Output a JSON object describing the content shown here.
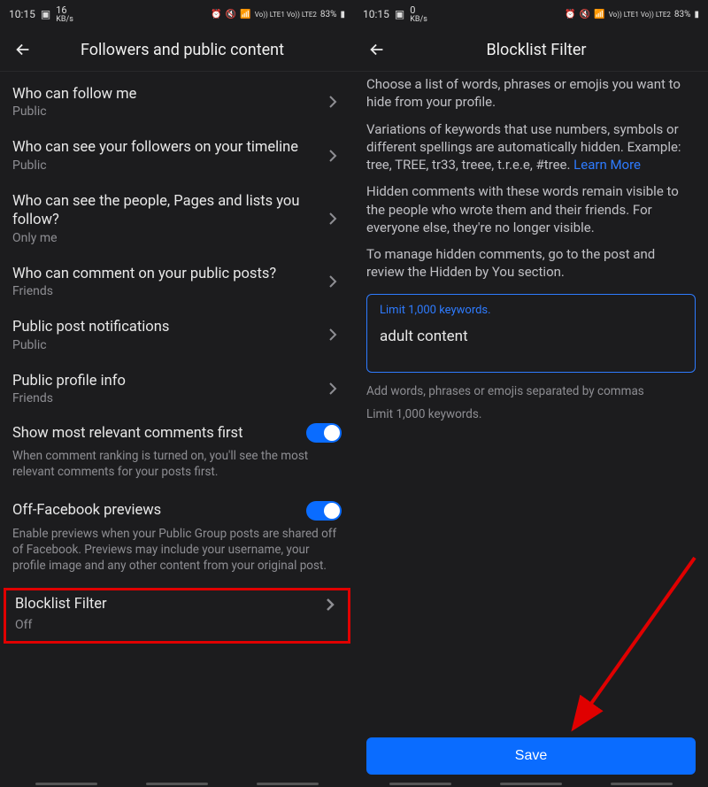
{
  "status": {
    "time": "10:15",
    "kbs_left": "16",
    "kbs_right": "0",
    "kbs_unit": "KB/s",
    "battery": "83%",
    "net": "Vo)) LTE1 Vo)) LTE2"
  },
  "left": {
    "title": "Followers and public content",
    "rows": [
      {
        "label": "Who can follow me",
        "sub": "Public"
      },
      {
        "label": "Who can see your followers on your timeline",
        "sub": "Public"
      },
      {
        "label": "Who can see the people, Pages and lists you follow?",
        "sub": "Only me"
      },
      {
        "label": "Who can comment on your public posts?",
        "sub": "Friends"
      },
      {
        "label": "Public post notifications",
        "sub": "Public"
      },
      {
        "label": "Public profile info",
        "sub": "Friends"
      }
    ],
    "toggle1_label": "Show most relevant comments first",
    "toggle1_desc": "When comment ranking is turned on, you'll see the most relevant comments for your posts first.",
    "toggle2_label": "Off-Facebook previews",
    "toggle2_desc": "Enable previews when your Public Group posts are shared off of Facebook. Previews may include your username, your profile image and any other content from your original post.",
    "blocklist_label": "Blocklist Filter",
    "blocklist_sub": "Off"
  },
  "right": {
    "title": "Blocklist Filter",
    "para1": "Choose a list of words, phrases or emojis you want to hide from your profile.",
    "para2a": "Variations of keywords that use numbers, symbols or different spellings are automatically hidden. Example: tree, TREE, tr33, treee, t.r.e.e, #tree. ",
    "learn_more": "Learn More",
    "para3": "Hidden comments with these words remain visible to the people who wrote them and their friends. For everyone else, they're no longer visible.",
    "para4": "To manage hidden comments, go to the post and review the Hidden by You section.",
    "input_limit": "Limit 1,000 keywords.",
    "input_value": "adult content",
    "helper1": "Add words, phrases or emojis separated by commas",
    "helper2": "Limit 1,000 keywords.",
    "save": "Save"
  }
}
